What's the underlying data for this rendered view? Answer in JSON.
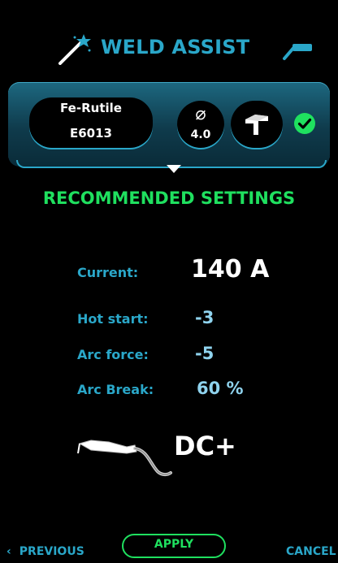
{
  "header": {
    "title": "WELD ASSIST",
    "left_icon": "magic-wand-icon",
    "right_icon": "welding-gun-icon"
  },
  "selection": {
    "electrode_type": "Fe-Rutile",
    "electrode_code": "E6013",
    "diameter_symbol": "⌀",
    "diameter_value": "4.0",
    "joint_icon": "joint-shape-icon",
    "status_icon": "check-icon"
  },
  "recommended": {
    "title": "RECOMMENDED SETTINGS",
    "current_label": "Current:",
    "current_value": "140 A",
    "hot_start_label": "Hot start:",
    "hot_start_value": "-3",
    "arc_force_label": "Arc force:",
    "arc_force_value": "-5",
    "arc_break_label": "Arc Break:",
    "arc_break_value": "60 %",
    "polarity": "DC+",
    "torch_icon": "electrode-holder-icon"
  },
  "footer": {
    "previous_label": "PREVIOUS",
    "apply_label": "APPLY",
    "cancel_label": "CANCEL"
  },
  "colors": {
    "accent_blue": "#2aa7c9",
    "accent_green": "#1fe05f",
    "value_blue": "#8fd3ee",
    "background": "#000000"
  }
}
